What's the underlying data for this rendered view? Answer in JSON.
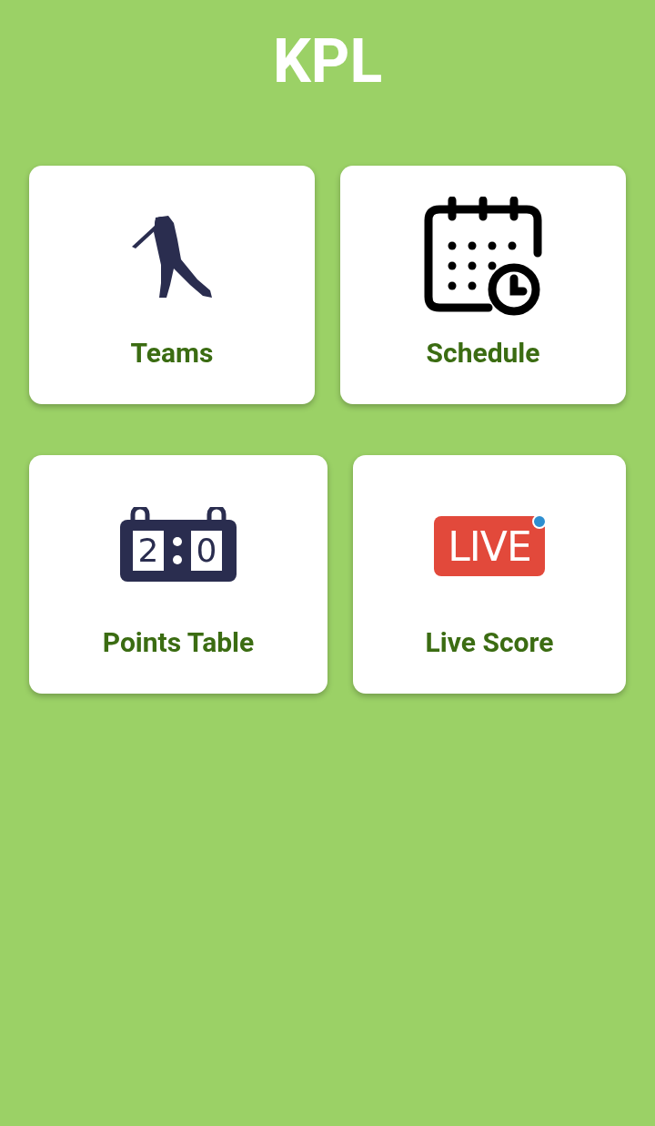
{
  "title": "KPL",
  "tiles": [
    {
      "kind": "teams",
      "label": "Teams"
    },
    {
      "kind": "schedule",
      "label": "Schedule"
    },
    {
      "kind": "points",
      "label": "Points Table",
      "score": [
        "2",
        "0"
      ]
    },
    {
      "kind": "live",
      "label": "Live Score",
      "badge": "LIVE"
    }
  ]
}
